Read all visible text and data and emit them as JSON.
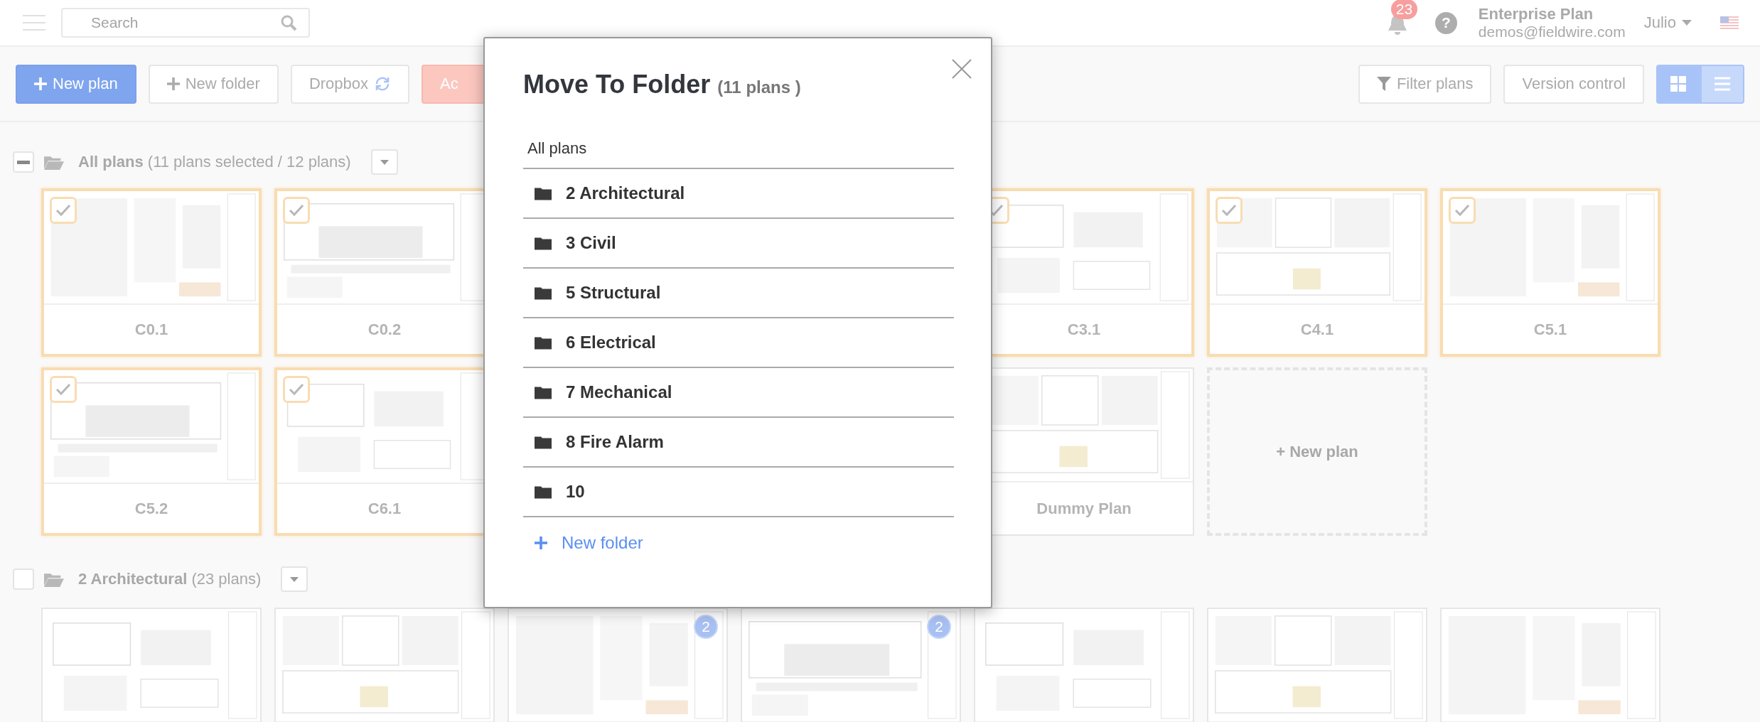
{
  "top_bar": {
    "search": {
      "placeholder": "Search"
    },
    "notifications": {
      "count": "23"
    },
    "help": "?",
    "account": {
      "plan": "Enterprise Plan",
      "email": "demos@fieldwire.com"
    },
    "user": "Julio"
  },
  "toolbar": {
    "left_buttons": [
      {
        "label": "New plan",
        "kind": "primary"
      },
      {
        "label": "New folder",
        "kind": "add"
      },
      {
        "label": "Dropbox",
        "kind": "sync"
      },
      {
        "label": "Ac",
        "kind": "danger"
      }
    ],
    "right_buttons": [
      {
        "label": "Filter plans",
        "kind": "filter"
      },
      {
        "label": "Version control",
        "kind": "plain"
      }
    ],
    "view_toggle": [
      {
        "kind": "grid",
        "selected": true
      },
      {
        "kind": "list",
        "selected": false
      }
    ]
  },
  "sections": [
    {
      "title": "All plans",
      "summary": "(11 plans selected / 12 plans)",
      "indeterminate": true,
      "cards": [
        {
          "title": "C0.1",
          "kind": "plan",
          "selected": true
        },
        {
          "title": "C0.2",
          "kind": "plan",
          "selected": true
        },
        {
          "title": "C3.1",
          "kind": "plan",
          "selected": true
        },
        {
          "title": "C4.1",
          "kind": "plan",
          "selected": true
        },
        {
          "title": "C5.1",
          "kind": "plan",
          "selected": true
        },
        {
          "title": "C5.2",
          "kind": "plan",
          "selected": true
        },
        {
          "title": "C6.1",
          "kind": "plan",
          "selected": true
        },
        {
          "title": "Dummy Plan",
          "kind": "plan",
          "selected": false
        },
        {
          "title": "+ New plan",
          "kind": "new"
        }
      ]
    },
    {
      "title": "2 Architectural",
      "summary": "(23 plans)",
      "indeterminate": false,
      "cards": [
        {
          "kind": "plan",
          "selected": false
        },
        {
          "kind": "plan",
          "selected": false
        },
        {
          "kind": "plan",
          "selected": false,
          "badge": "2"
        },
        {
          "kind": "plan",
          "selected": false,
          "badge": "2"
        },
        {
          "kind": "plan",
          "selected": false
        },
        {
          "kind": "plan",
          "selected": false
        },
        {
          "kind": "plan",
          "selected": false
        }
      ]
    }
  ],
  "modal": {
    "title": "Move To Folder",
    "count": "(11 plans )",
    "destinations": [
      {
        "label": "All plans",
        "kind": "root"
      },
      {
        "label": "2 Architectural",
        "kind": "folder"
      },
      {
        "label": "3 Civil",
        "kind": "folder"
      },
      {
        "label": "5 Structural",
        "kind": "folder"
      },
      {
        "label": "6 Electrical",
        "kind": "folder"
      },
      {
        "label": "7 Mechanical",
        "kind": "folder"
      },
      {
        "label": "8 Fire Alarm",
        "kind": "folder"
      },
      {
        "label": "10",
        "kind": "folder"
      }
    ],
    "new_folder": "New folder"
  }
}
